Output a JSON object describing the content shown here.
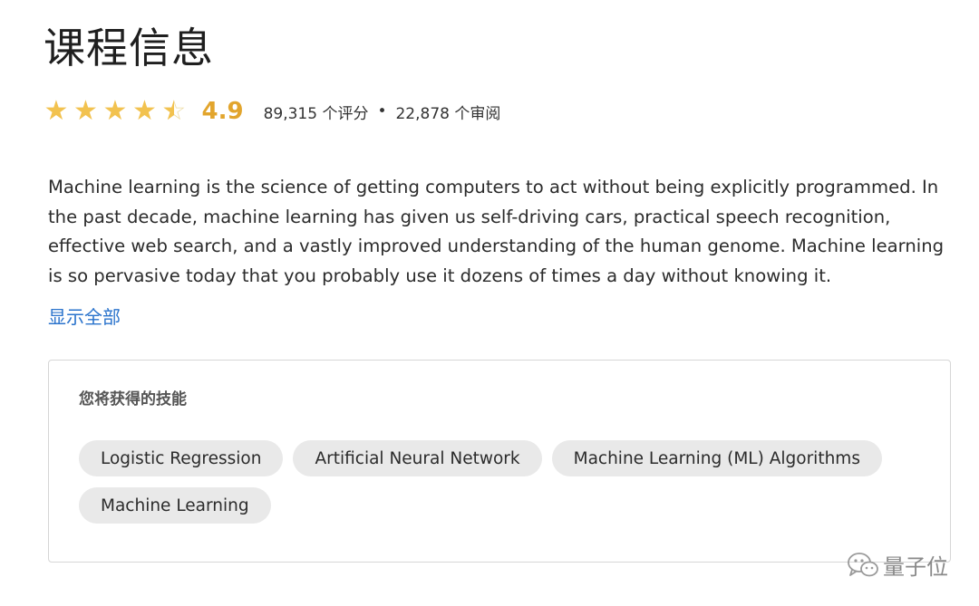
{
  "course": {
    "title": "课程信息",
    "rating": {
      "stars": 4.9,
      "value": "4.9",
      "count_text": "89,315 个评分",
      "separator": "•",
      "reviews_text": "22,878 个审阅"
    },
    "description": "Machine learning is the science of getting computers to act without being explicitly programmed. In the past decade, machine learning has given us self-driving cars, practical speech recognition, effective web search, and a vastly improved understanding of the human genome. Machine learning is so pervasive today that you probably use it dozens of times a day without knowing it.",
    "show_all_label": "显示全部"
  },
  "skills": {
    "title": "您将获得的技能",
    "items": [
      "Logistic Regression",
      "Artificial Neural Network",
      "Machine Learning (ML) Algorithms",
      "Machine Learning"
    ]
  },
  "watermark": {
    "text": "量子位",
    "icon": "wechat-icon"
  },
  "colors": {
    "star": "#f2c24f",
    "rating_value": "#e2a52d",
    "link": "#2a73cc",
    "pill_bg": "#e9e9e9"
  }
}
